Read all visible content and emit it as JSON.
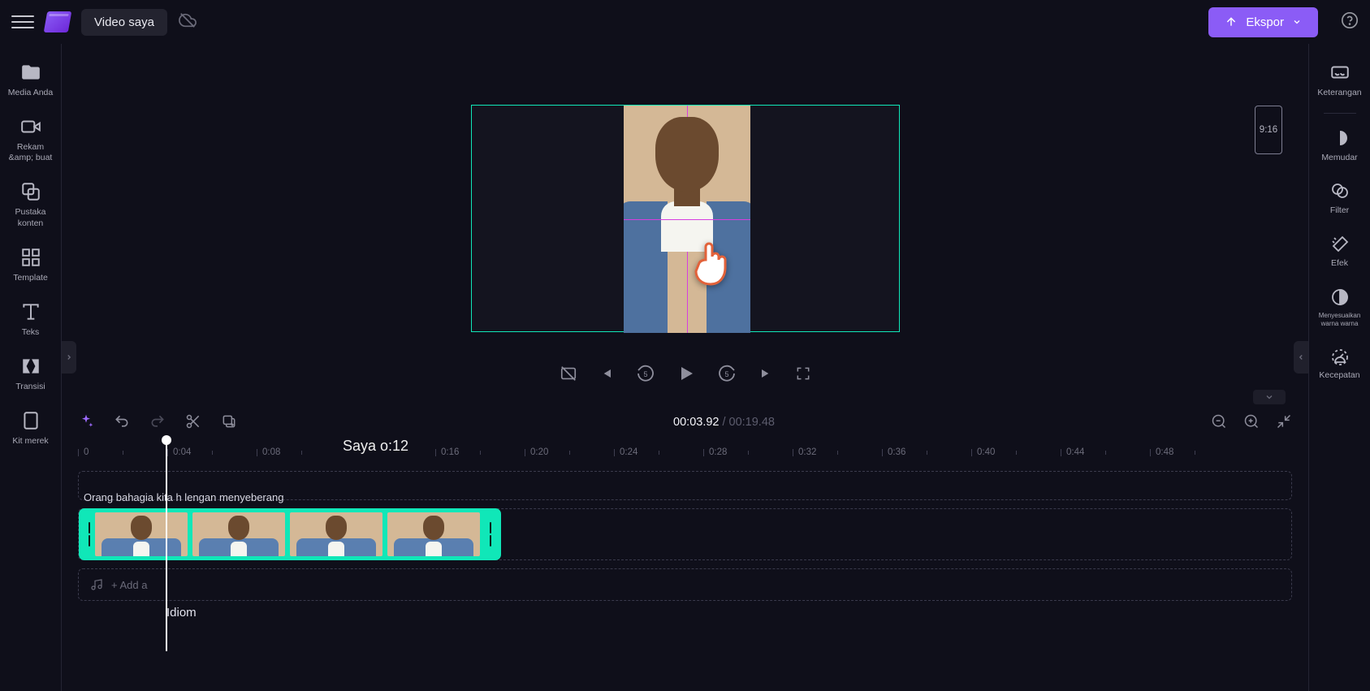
{
  "topbar": {
    "project_title": "Video saya",
    "export_label": "Ekspor"
  },
  "left_sidebar": {
    "items": [
      {
        "label": "Media Anda"
      },
      {
        "label": "Rekam\n&amp; buat"
      },
      {
        "label": "Pustaka\nkonten"
      },
      {
        "label": "Template"
      },
      {
        "label": "Teks"
      },
      {
        "label": "Transisi"
      },
      {
        "label": "Kit merek"
      }
    ]
  },
  "right_sidebar": {
    "items": [
      {
        "label": "Keterangan"
      },
      {
        "label": "Memudar"
      },
      {
        "label": "Filter"
      },
      {
        "label": "Efek"
      },
      {
        "label": "Menyesuaikan warna\nwarna"
      },
      {
        "label": "Kecepatan"
      }
    ]
  },
  "preview": {
    "aspect_label": "9:16"
  },
  "timeline": {
    "current_time": "00:03.92",
    "total_time": "00:19.48",
    "marker_text": "Saya o:12",
    "ruler_labels": [
      "0",
      "0:04",
      "0:08",
      "0:16",
      "0:20",
      "0:24",
      "0:28",
      "0:32",
      "0:36",
      "0:40",
      "0:44",
      "0:48"
    ],
    "clip_title": "Orang bahagia kita h lengan menyeberang",
    "audio_placeholder": "+ Add a",
    "idiom_text": "Idiom"
  }
}
